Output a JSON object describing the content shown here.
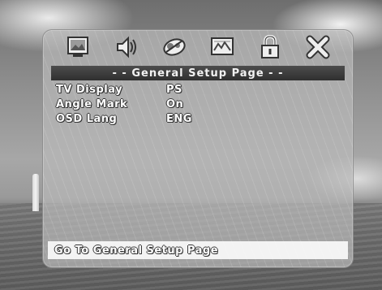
{
  "toolbar": {
    "icons": [
      {
        "name": "general-setup-icon"
      },
      {
        "name": "audio-setup-icon"
      },
      {
        "name": "dolby-setup-icon"
      },
      {
        "name": "video-setup-icon"
      },
      {
        "name": "password-lock-icon"
      },
      {
        "name": "exit-icon"
      }
    ]
  },
  "page_title": "- - General Setup Page - -",
  "settings": [
    {
      "label": "TV Display",
      "value": "PS"
    },
    {
      "label": "Angle Mark",
      "value": "On"
    },
    {
      "label": "OSD Lang",
      "value": "ENG"
    }
  ],
  "status_text": "Go To General Setup Page"
}
